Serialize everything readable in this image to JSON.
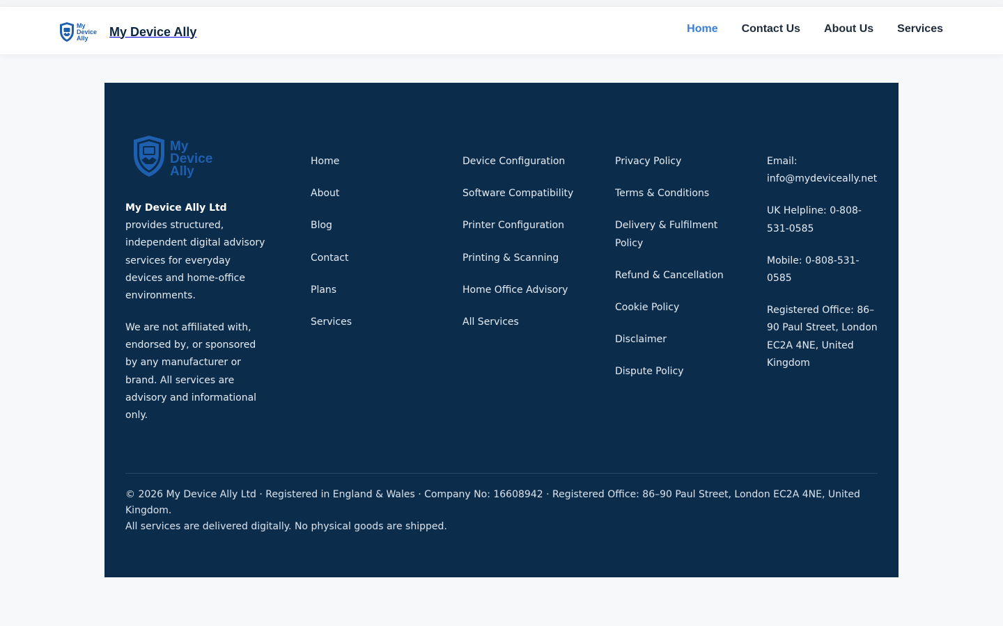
{
  "header": {
    "brand_name": "My Device Ally",
    "logo_text": [
      "My",
      "Device",
      "Ally"
    ],
    "nav": [
      {
        "label": "Home",
        "active": true
      },
      {
        "label": "Contact Us",
        "active": false
      },
      {
        "label": "About Us",
        "active": false
      },
      {
        "label": "Services",
        "active": false
      }
    ]
  },
  "footer": {
    "logo_text": [
      "My",
      "Device",
      "Ally"
    ],
    "company_name": "My Device Ally Ltd",
    "company_desc": " provides structured, independent digital advisory services for everyday devices and home-office environments.",
    "disclaimer": "We are not affiliated with, endorsed by, or sponsored by any manufacturer or brand. All services are advisory and informational only.",
    "quick_links": [
      "Home",
      "About",
      "Blog",
      "Contact",
      "Plans",
      "Services"
    ],
    "services": [
      "Device Configuration",
      "Software Compatibility",
      "Printer Configuration",
      "Printing & Scanning",
      "Home Office Advisory",
      "All Services"
    ],
    "policies": [
      "Privacy Policy",
      "Terms & Conditions",
      "Delivery & Fulfilment Policy",
      "Refund & Cancellation",
      "Cookie Policy",
      "Disclaimer",
      "Dispute Policy"
    ],
    "contact": [
      "Email: info@mydeviceally.net",
      "UK Helpline: 0-808-531-0585",
      "Mobile: 0-808-531-0585",
      "Registered Office: 86–90 Paul Street, London EC2A 4NE, United Kingdom"
    ],
    "copyright": "© 2026 My Device Ally Ltd · Registered in England & Wales · Company No: 16608942 · Registered Office: 86–90 Paul Street, London EC2A 4NE, United Kingdom.",
    "delivery_note": "All services are delivered digitally. No physical goods are shipped."
  },
  "colors": {
    "footer_bg": "#0c2c4c",
    "accent": "#3e7fd6",
    "logo_blue": "#1f5fb0",
    "nav_text": "#1d2a3a"
  },
  "icons": {
    "brand_logo": "shield-handshake-icon"
  }
}
